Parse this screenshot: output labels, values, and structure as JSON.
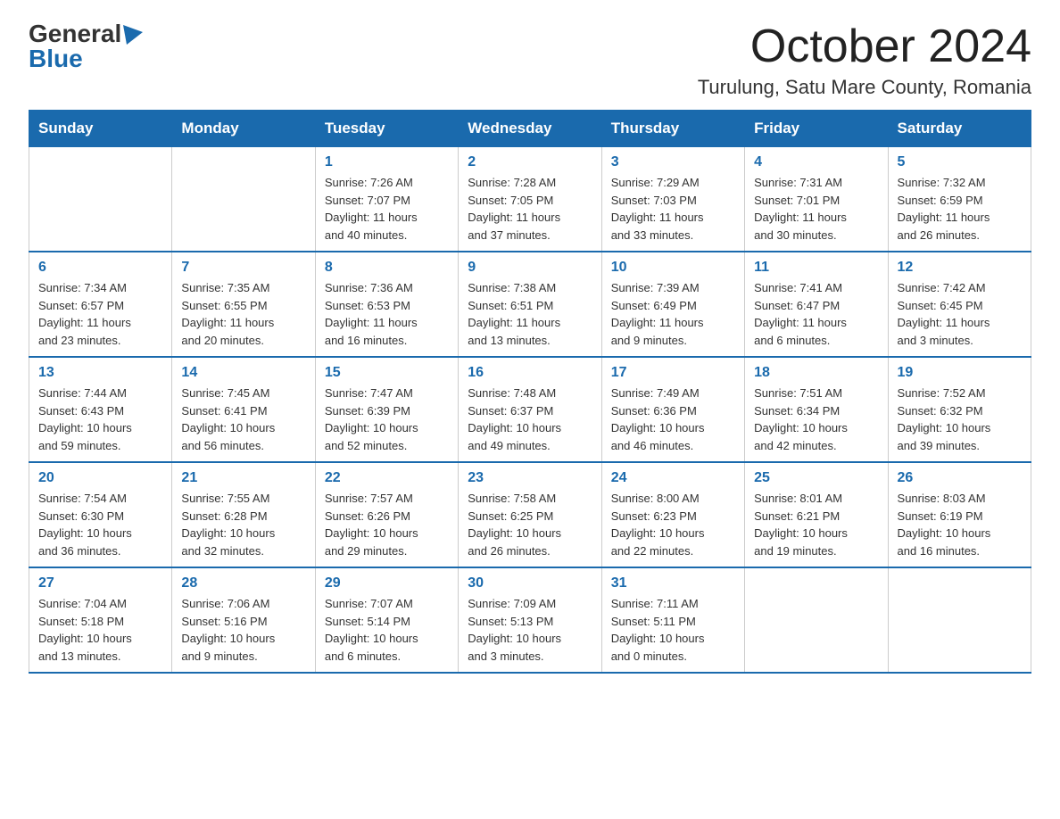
{
  "header": {
    "logo_general": "General",
    "logo_blue": "Blue",
    "month_title": "October 2024",
    "location": "Turulung, Satu Mare County, Romania"
  },
  "days_of_week": [
    "Sunday",
    "Monday",
    "Tuesday",
    "Wednesday",
    "Thursday",
    "Friday",
    "Saturday"
  ],
  "weeks": [
    [
      {
        "day": "",
        "info": ""
      },
      {
        "day": "",
        "info": ""
      },
      {
        "day": "1",
        "info": "Sunrise: 7:26 AM\nSunset: 7:07 PM\nDaylight: 11 hours\nand 40 minutes."
      },
      {
        "day": "2",
        "info": "Sunrise: 7:28 AM\nSunset: 7:05 PM\nDaylight: 11 hours\nand 37 minutes."
      },
      {
        "day": "3",
        "info": "Sunrise: 7:29 AM\nSunset: 7:03 PM\nDaylight: 11 hours\nand 33 minutes."
      },
      {
        "day": "4",
        "info": "Sunrise: 7:31 AM\nSunset: 7:01 PM\nDaylight: 11 hours\nand 30 minutes."
      },
      {
        "day": "5",
        "info": "Sunrise: 7:32 AM\nSunset: 6:59 PM\nDaylight: 11 hours\nand 26 minutes."
      }
    ],
    [
      {
        "day": "6",
        "info": "Sunrise: 7:34 AM\nSunset: 6:57 PM\nDaylight: 11 hours\nand 23 minutes."
      },
      {
        "day": "7",
        "info": "Sunrise: 7:35 AM\nSunset: 6:55 PM\nDaylight: 11 hours\nand 20 minutes."
      },
      {
        "day": "8",
        "info": "Sunrise: 7:36 AM\nSunset: 6:53 PM\nDaylight: 11 hours\nand 16 minutes."
      },
      {
        "day": "9",
        "info": "Sunrise: 7:38 AM\nSunset: 6:51 PM\nDaylight: 11 hours\nand 13 minutes."
      },
      {
        "day": "10",
        "info": "Sunrise: 7:39 AM\nSunset: 6:49 PM\nDaylight: 11 hours\nand 9 minutes."
      },
      {
        "day": "11",
        "info": "Sunrise: 7:41 AM\nSunset: 6:47 PM\nDaylight: 11 hours\nand 6 minutes."
      },
      {
        "day": "12",
        "info": "Sunrise: 7:42 AM\nSunset: 6:45 PM\nDaylight: 11 hours\nand 3 minutes."
      }
    ],
    [
      {
        "day": "13",
        "info": "Sunrise: 7:44 AM\nSunset: 6:43 PM\nDaylight: 10 hours\nand 59 minutes."
      },
      {
        "day": "14",
        "info": "Sunrise: 7:45 AM\nSunset: 6:41 PM\nDaylight: 10 hours\nand 56 minutes."
      },
      {
        "day": "15",
        "info": "Sunrise: 7:47 AM\nSunset: 6:39 PM\nDaylight: 10 hours\nand 52 minutes."
      },
      {
        "day": "16",
        "info": "Sunrise: 7:48 AM\nSunset: 6:37 PM\nDaylight: 10 hours\nand 49 minutes."
      },
      {
        "day": "17",
        "info": "Sunrise: 7:49 AM\nSunset: 6:36 PM\nDaylight: 10 hours\nand 46 minutes."
      },
      {
        "day": "18",
        "info": "Sunrise: 7:51 AM\nSunset: 6:34 PM\nDaylight: 10 hours\nand 42 minutes."
      },
      {
        "day": "19",
        "info": "Sunrise: 7:52 AM\nSunset: 6:32 PM\nDaylight: 10 hours\nand 39 minutes."
      }
    ],
    [
      {
        "day": "20",
        "info": "Sunrise: 7:54 AM\nSunset: 6:30 PM\nDaylight: 10 hours\nand 36 minutes."
      },
      {
        "day": "21",
        "info": "Sunrise: 7:55 AM\nSunset: 6:28 PM\nDaylight: 10 hours\nand 32 minutes."
      },
      {
        "day": "22",
        "info": "Sunrise: 7:57 AM\nSunset: 6:26 PM\nDaylight: 10 hours\nand 29 minutes."
      },
      {
        "day": "23",
        "info": "Sunrise: 7:58 AM\nSunset: 6:25 PM\nDaylight: 10 hours\nand 26 minutes."
      },
      {
        "day": "24",
        "info": "Sunrise: 8:00 AM\nSunset: 6:23 PM\nDaylight: 10 hours\nand 22 minutes."
      },
      {
        "day": "25",
        "info": "Sunrise: 8:01 AM\nSunset: 6:21 PM\nDaylight: 10 hours\nand 19 minutes."
      },
      {
        "day": "26",
        "info": "Sunrise: 8:03 AM\nSunset: 6:19 PM\nDaylight: 10 hours\nand 16 minutes."
      }
    ],
    [
      {
        "day": "27",
        "info": "Sunrise: 7:04 AM\nSunset: 5:18 PM\nDaylight: 10 hours\nand 13 minutes."
      },
      {
        "day": "28",
        "info": "Sunrise: 7:06 AM\nSunset: 5:16 PM\nDaylight: 10 hours\nand 9 minutes."
      },
      {
        "day": "29",
        "info": "Sunrise: 7:07 AM\nSunset: 5:14 PM\nDaylight: 10 hours\nand 6 minutes."
      },
      {
        "day": "30",
        "info": "Sunrise: 7:09 AM\nSunset: 5:13 PM\nDaylight: 10 hours\nand 3 minutes."
      },
      {
        "day": "31",
        "info": "Sunrise: 7:11 AM\nSunset: 5:11 PM\nDaylight: 10 hours\nand 0 minutes."
      },
      {
        "day": "",
        "info": ""
      },
      {
        "day": "",
        "info": ""
      }
    ]
  ]
}
